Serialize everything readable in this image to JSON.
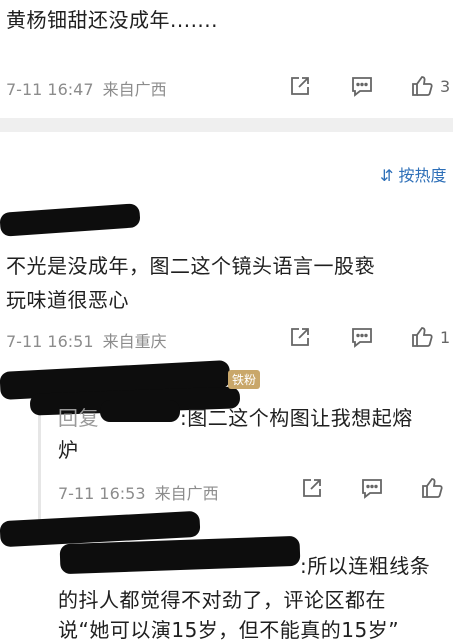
{
  "top_comment": {
    "text": "黄杨钿甜还没成年.......",
    "date": "7-11 16:47",
    "source": "来自广西",
    "like_count": "3"
  },
  "sort": {
    "icon": "sort-icon",
    "label": "按热度"
  },
  "comment2": {
    "line1": "不光是没成年，图二这个镜头语言一股亵",
    "line2": "玩味道很恶心",
    "date": "7-11 16:51",
    "source": "来自重庆",
    "like_count": "1"
  },
  "reply1": {
    "prefix": "回复",
    "badge": "铁粉",
    "line1": ":图二这个构图让我想起熔",
    "line2": "炉",
    "date": "7-11 16:53",
    "source": "来自广西"
  },
  "reply2": {
    "line1": ":所以连粗线条",
    "line2": "的抖人都觉得不对劲了，评论区都在",
    "line3": "说“她可以演15岁，但不能真的15岁”"
  },
  "colors": {
    "meta_gray": "#8c8c8c",
    "link_blue": "#2d6fb8",
    "band": "#efefef",
    "redaction": "#0d0d0d"
  }
}
